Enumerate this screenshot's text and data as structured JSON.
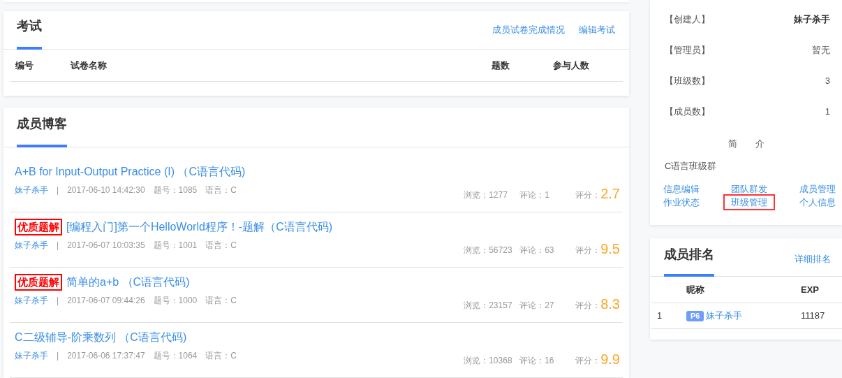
{
  "exam": {
    "title": "考试",
    "links": [
      "成员试卷完成情况",
      "编辑考试"
    ],
    "columns": [
      "编号",
      "试卷名称",
      "题数",
      "参与人数"
    ]
  },
  "blogs": {
    "title": "成员博客",
    "items": [
      {
        "title": "A+B for Input-Output Practice (I) （C语言代码)",
        "author": "妹子杀手",
        "separator": "|",
        "date": "2017-06-10 14:42:30",
        "problem": "题号：1085",
        "language": "语言：C",
        "views": "浏览：1277",
        "comments": "评论：1",
        "score_label": "评分：",
        "score": "2.7"
      },
      {
        "badge": "优质题解",
        "title": "[编程入门]第一个HelloWorld程序！-题解（C语言代码)",
        "author": "妹子杀手",
        "separator": "|",
        "date": "2017-06-07 10:03:35",
        "problem": "题号：1001",
        "language": "语言：C",
        "views": "浏览：56723",
        "comments": "评论：63",
        "score_label": "评分：",
        "score": "9.5"
      },
      {
        "badge": "优质题解",
        "title": "简单的a+b （C语言代码)",
        "author": "妹子杀手",
        "separator": "|",
        "date": "2017-06-07 09:44:26",
        "problem": "题号：1000",
        "language": "语言：C",
        "views": "浏览：23157",
        "comments": "评论：27",
        "score_label": "评分：",
        "score": "8.3"
      },
      {
        "title": "C二级辅导-阶乘数列 （C语言代码)",
        "author": "妹子杀手",
        "separator": "|",
        "date": "2017-06-06 17:37:47",
        "problem": "题号：1064",
        "language": "语言：C",
        "views": "浏览：10368",
        "comments": "评论：16",
        "score_label": "评分：",
        "score": "9.9"
      }
    ]
  },
  "info": {
    "rows": [
      {
        "label": "【创建人】",
        "value": "妹子杀手",
        "bold": true
      },
      {
        "label": "【管理员】",
        "value": "暂无",
        "bold": false
      },
      {
        "label": "【班级数】",
        "value": "3",
        "bold": false
      },
      {
        "label": "【成员数】",
        "value": "1",
        "bold": false
      }
    ],
    "intro_heading": [
      "简",
      "介"
    ],
    "intro": "C语言班级群",
    "links": [
      {
        "label": "信息编辑",
        "highlighted": false
      },
      {
        "label": "团队群发",
        "highlighted": false
      },
      {
        "label": "成员管理",
        "highlighted": false
      },
      {
        "label": "作业状态",
        "highlighted": false
      },
      {
        "label": "班级管理",
        "highlighted": true
      },
      {
        "label": "个人信息",
        "highlighted": false
      }
    ]
  },
  "ranking": {
    "title": "成员排名",
    "link": "详细排名",
    "columns": [
      "昵称",
      "EXP"
    ],
    "rows": [
      {
        "rank": "1",
        "level": "P6",
        "name": "妹子杀手",
        "exp": "11187"
      }
    ]
  }
}
